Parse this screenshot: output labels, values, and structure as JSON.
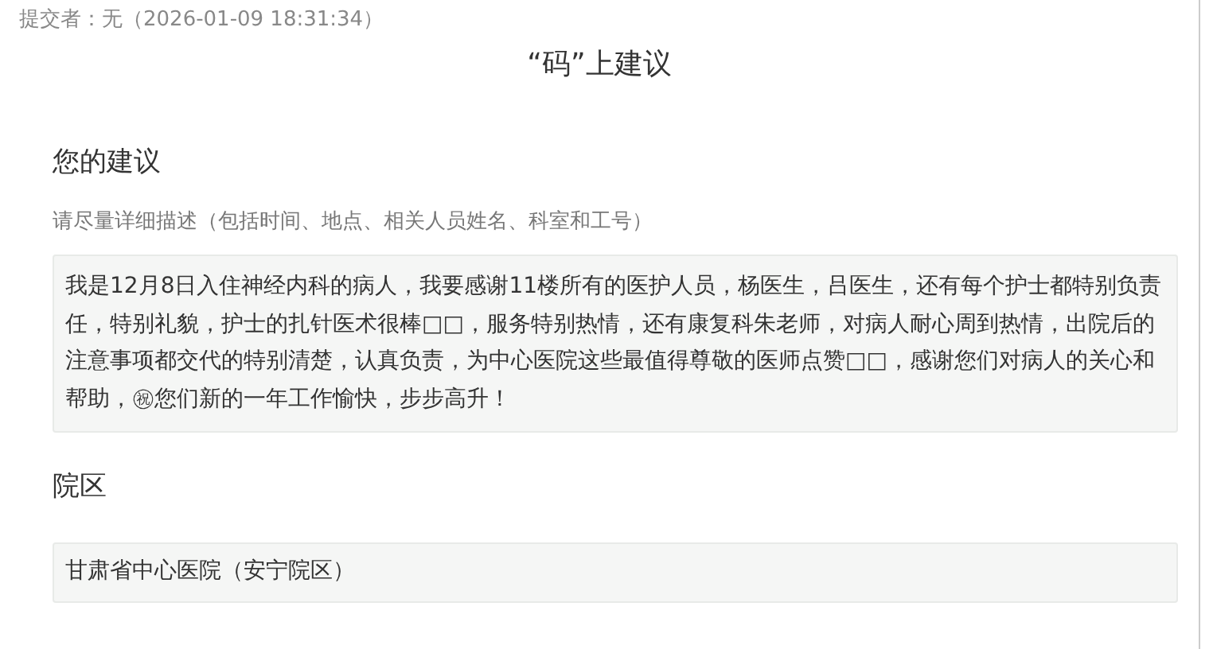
{
  "submitter": "提交者：无（2026-01-09 18:31:34）",
  "title": "“码”上建议",
  "sections": [
    {
      "heading": "您的建议",
      "hint": "请尽量详细描述（包括时间、地点、相关人员姓名、科室和工号）",
      "value": "我是12月8日入住神经内科的病人，我要感谢11楼所有的医护人员，杨医生，吕医生，还有每个护士都特别负责任，特别礼貌，护士的扎针医术很棒□□，服务特别热情，还有康复科朱老师，对病人耐心周到热情，出院后的注意事项都交代的特别清楚，认真负责，为中心医院这些最值得尊敬的医师点赞□□，感谢您们对病人的关心和帮助，㊗您们新的一年工作愉快，步步高升！"
    },
    {
      "heading": "院区",
      "value": "甘肃省中心医院（安宁院区）"
    }
  ]
}
